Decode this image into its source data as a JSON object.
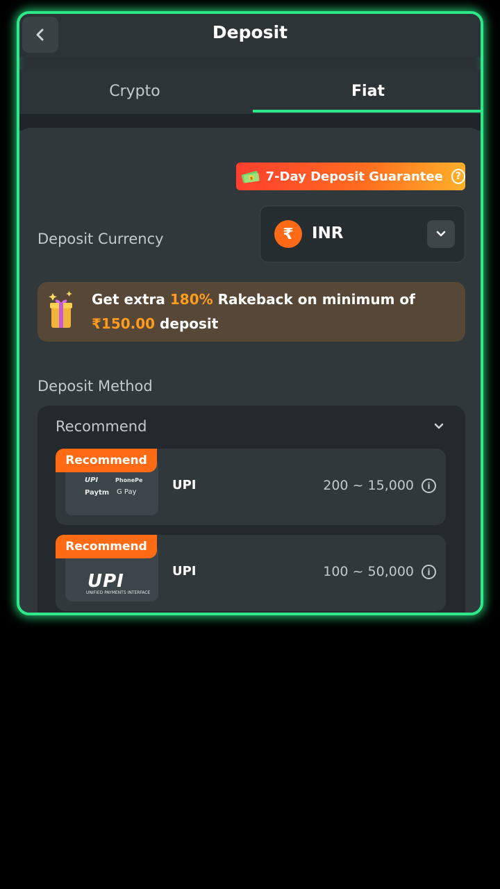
{
  "header": {
    "title": "Deposit"
  },
  "tabs": [
    {
      "label": "Crypto",
      "active": false
    },
    {
      "label": "Fiat",
      "active": true
    }
  ],
  "guarantee": {
    "label": "7-Day Deposit Guarantee",
    "help": "?"
  },
  "currency": {
    "label": "Deposit Currency",
    "symbol": "₹",
    "code": "INR"
  },
  "promo": {
    "prefix": "Get extra ",
    "percent": "180%",
    "middle": " Rakeback on minimum of",
    "amount": "₹150.00",
    "suffix": " deposit"
  },
  "method": {
    "label": "Deposit Method",
    "group_title": "Recommend",
    "cards": [
      {
        "badge": "Recommend",
        "name": "UPI",
        "range": "200 ~ 15,000",
        "logo_texts": [
          "UPI",
          "PhonePe",
          "Paytm",
          "G Pay"
        ]
      },
      {
        "badge": "Recommend",
        "name": "UPI",
        "range": "100 ~ 50,000",
        "logo_texts": [
          "UPI",
          "UNIFIED PAYMENTS INTERFACE"
        ]
      }
    ]
  },
  "colors": {
    "accent": "#2ee88a",
    "orange": "#ff6a14",
    "highlight": "#ff9b1f"
  },
  "icons": [
    "chevron-left-icon",
    "help-icon",
    "rupee-icon",
    "chevron-down-icon",
    "gift-icon",
    "info-icon"
  ]
}
